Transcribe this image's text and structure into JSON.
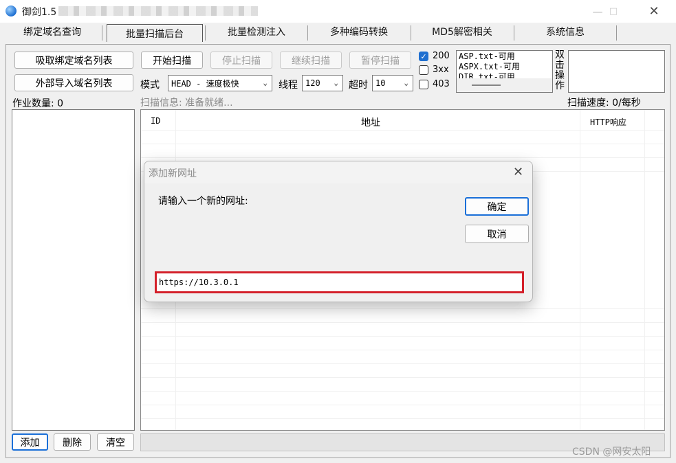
{
  "window": {
    "title": "御剑1.5",
    "minimize_icon": "minimize-icon",
    "maximize_icon": "maximize-icon",
    "close_icon": "close-icon"
  },
  "tabs": [
    "绑定域名查询",
    "批量扫描后台",
    "批量检测注入",
    "多种编码转换",
    "MD5解密相关",
    "系统信息"
  ],
  "left": {
    "fetch_button": "吸取绑定域名列表",
    "import_button": "外部导入域名列表",
    "job_count": "作业数量: 0",
    "add_button": "添加",
    "delete_button": "删除",
    "clear_button": "清空"
  },
  "toolbar": {
    "start_button": "开始扫描",
    "stop_button": "停止扫描",
    "continue_button": "继续扫描",
    "pause_button": "暂停扫描",
    "mode_label": "模式",
    "mode_value": "HEAD - 速度极快",
    "threads_label": "线程",
    "threads_value": "120",
    "timeout_label": "超时",
    "timeout_value": "10",
    "cb_200": "200",
    "cb_3xx": "3xx",
    "cb_403": "403",
    "dict_items": [
      "ASP.txt-可用",
      "ASPX.txt-可用",
      "DIR.txt-可用"
    ],
    "double_click_label": "双击操作",
    "scan_info": "扫描信息: 准备就绪...",
    "scan_speed": "扫描速度: 0/每秒"
  },
  "table": {
    "col_id": "ID",
    "col_address": "地址",
    "col_http": "HTTP响应"
  },
  "dialog": {
    "title": "添加新网址",
    "prompt": "请输入一个新的网址:",
    "ok_button": "确定",
    "cancel_button": "取消",
    "input_value": "https://10.3.0.1"
  },
  "watermark": "CSDN @网安太阳"
}
